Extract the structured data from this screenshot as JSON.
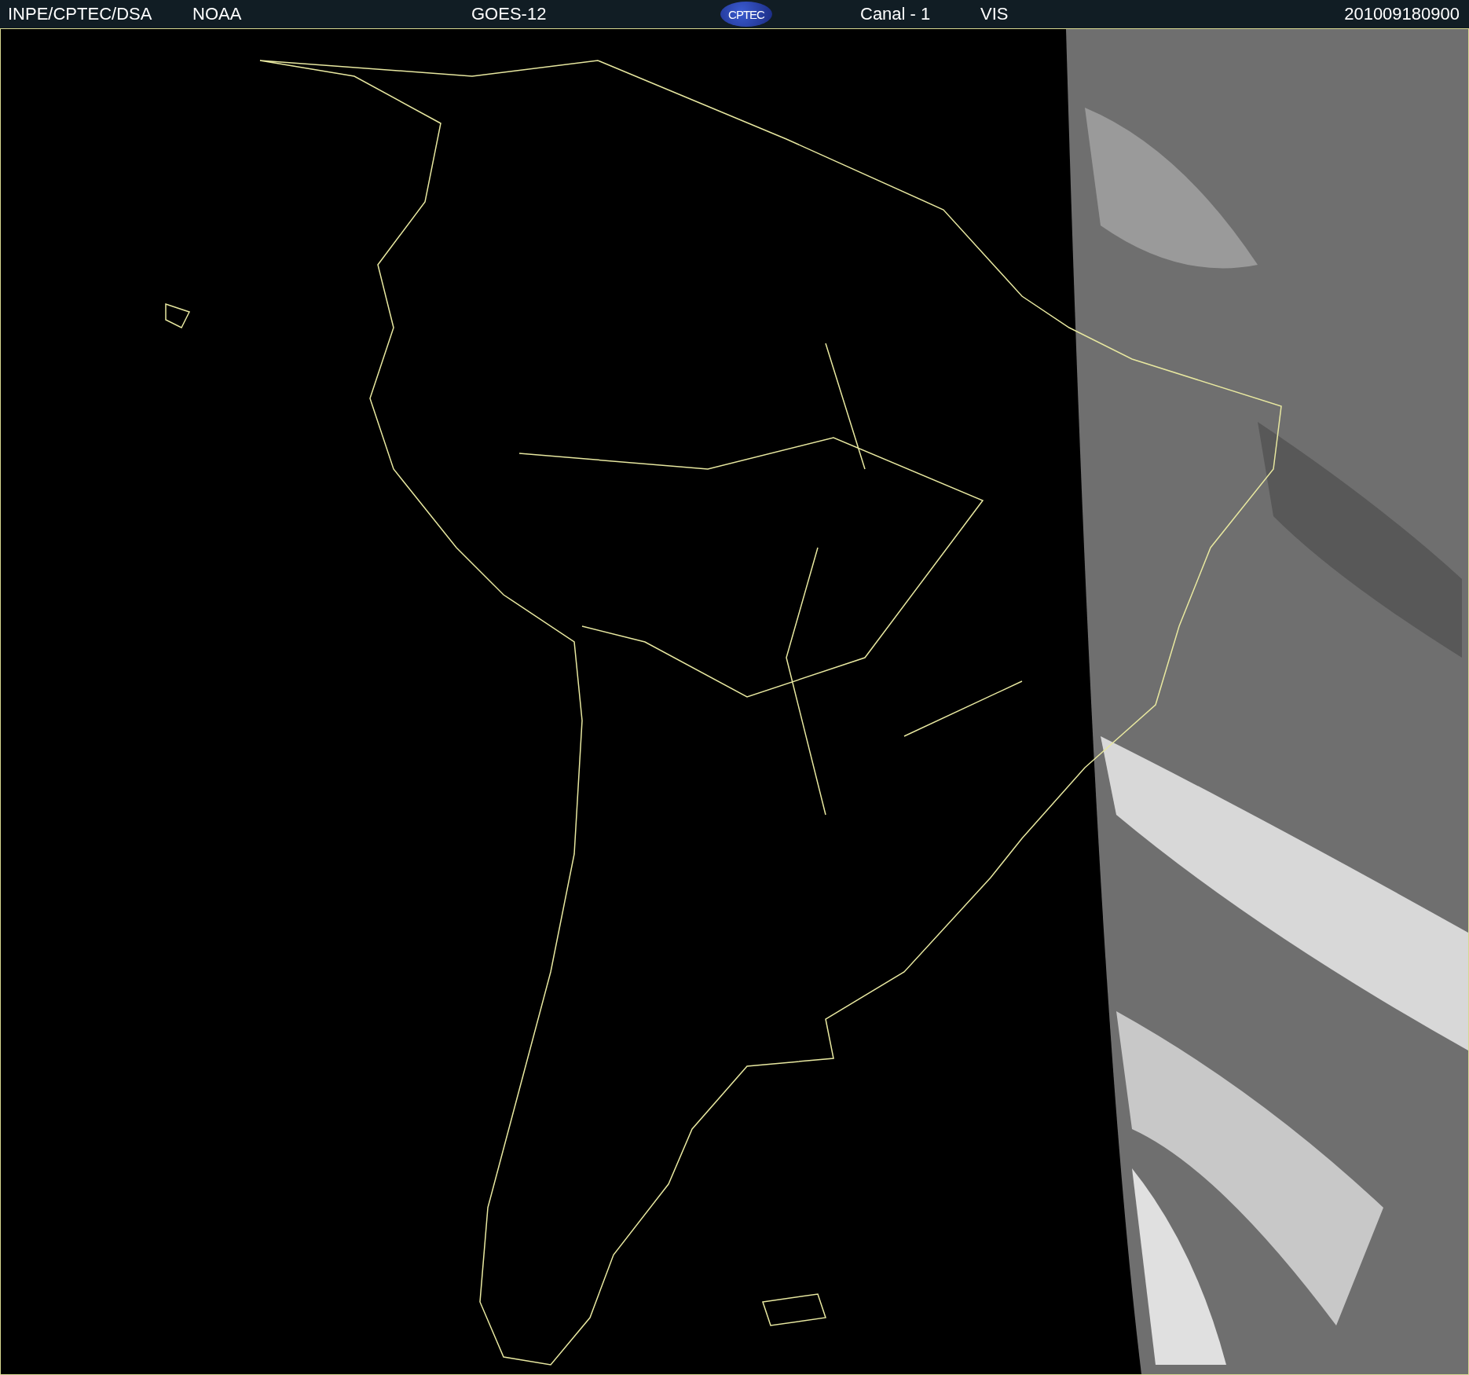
{
  "header": {
    "source": "INPE/CPTEC/DSA",
    "agency": "NOAA",
    "satellite": "GOES-12",
    "logo": "CPTEC",
    "channel": "Canal - 1",
    "band": "VIS",
    "timestamp": "201009180900"
  }
}
